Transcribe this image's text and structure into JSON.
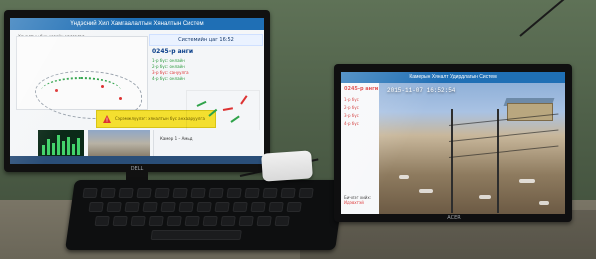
{
  "left_monitor": {
    "app_title": "Үндэсний Хил Хамгаалалтын Хяналтын Систем",
    "map_caption": "Хяналтын бүх цэгийн мэдээлэл",
    "system_time": "Системийн цаг 16:52",
    "station_label": "0245-р анги",
    "metrics": [
      "1-р бүс: онлайн",
      "2-р бүс: онлайн",
      "3-р бүс: сануулга",
      "4-р бүс: онлайн"
    ],
    "alert_text": "Сэрэмжлүүлэг: хяналтын бүс анхааруулга",
    "mini_camera_caption": "Камер 1 – Амьд",
    "brand": "DELL"
  },
  "right_monitor": {
    "app_title": "Камерын Хяналт Удирдлагын Систем",
    "timestamp": "2015-11-07 16:52:54",
    "panel_title": "0245-р анги",
    "panel_items": [
      "1-р бүс",
      "2-р бүс",
      "3-р бүс",
      "4-р бүс"
    ],
    "panel_footer_label": "Бичлэг хийх:",
    "panel_footer_status": "Идэвхтэй",
    "brand": "ACER"
  },
  "colors": {
    "accent_blue": "#1f6fb5",
    "alert_yellow": "#f4df2f",
    "status_red": "#d33",
    "status_green": "#2fa34a"
  },
  "icons": [
    "alert-icon"
  ]
}
